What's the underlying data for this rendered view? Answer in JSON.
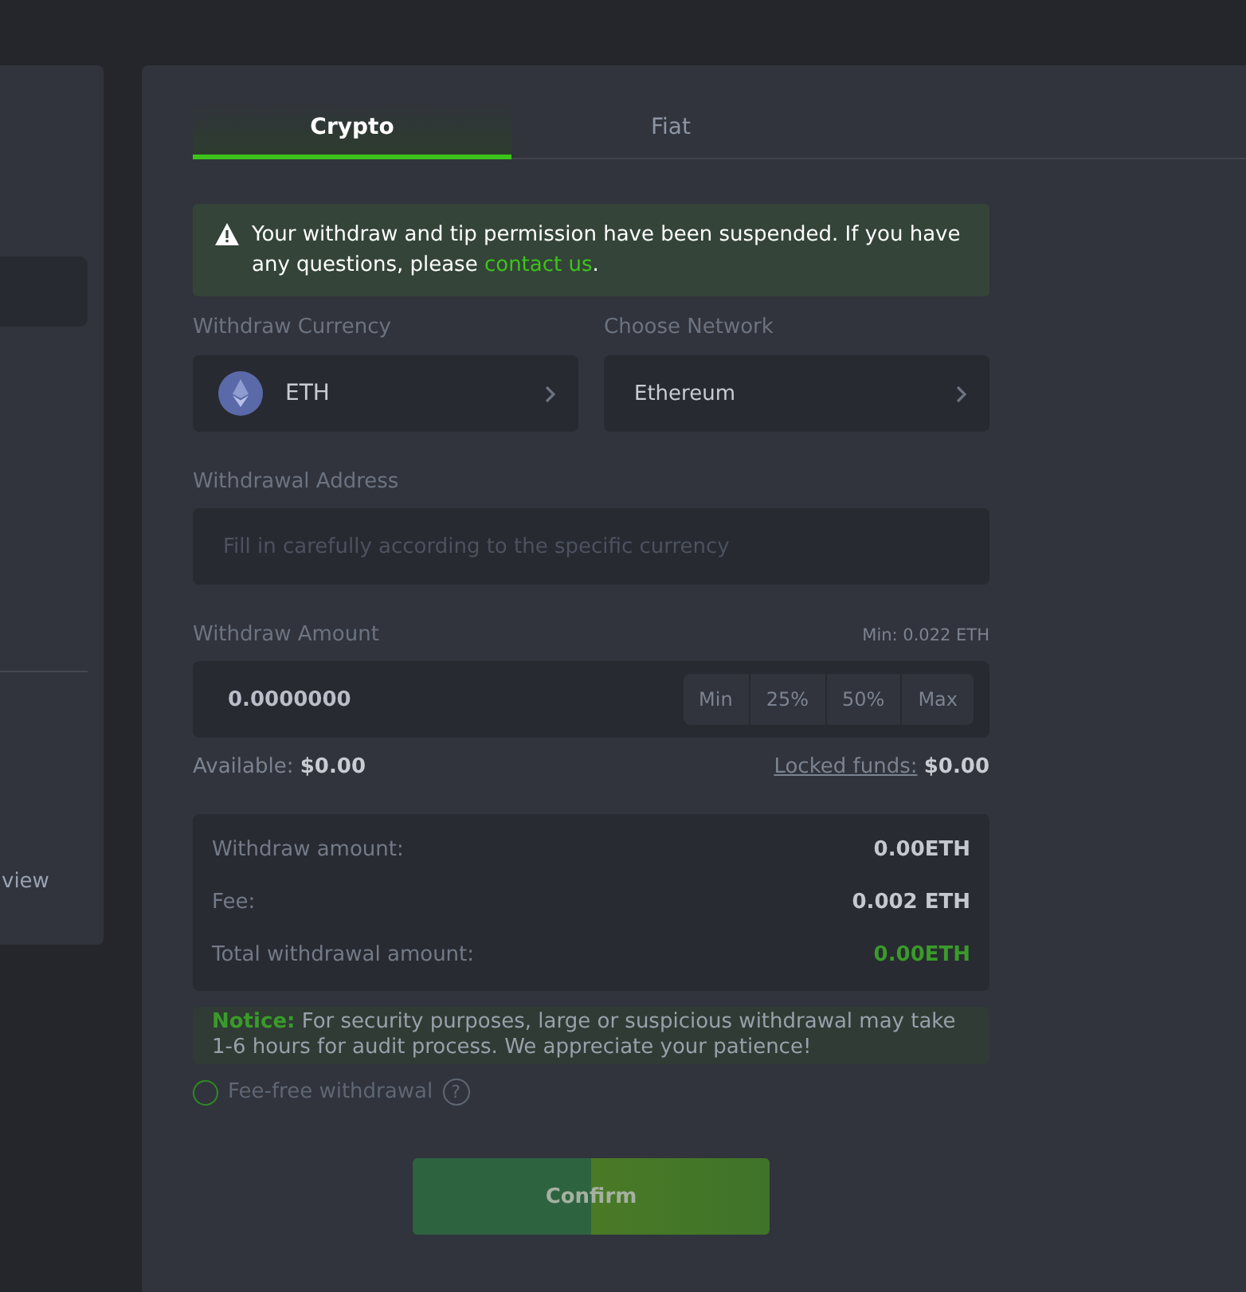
{
  "sidebar": {
    "footer_link": "view"
  },
  "tabs": [
    {
      "label": "Crypto",
      "selected": true
    },
    {
      "label": "Fiat",
      "selected": false
    }
  ],
  "alert": {
    "text": "Your withdraw and tip permission have been suspended. If you have any questions, please ",
    "link": "contact us",
    "after": "."
  },
  "currency": {
    "label": "Withdraw Currency",
    "value": "ETH"
  },
  "network": {
    "label": "Choose Network",
    "value": "Ethereum"
  },
  "address": {
    "label": "Withdrawal Address",
    "placeholder": "Fill in carefully according to the specific currency"
  },
  "amount": {
    "label": "Withdraw Amount",
    "min_note": "Min: 0.022 ETH",
    "value": "0.0000000",
    "quick_buttons": [
      "Min",
      "25%",
      "50%",
      "Max"
    ]
  },
  "available": {
    "label": "Available:",
    "value": "$0.00"
  },
  "locked": {
    "label": "Locked funds:",
    "value": "$0.00"
  },
  "summary": [
    {
      "label": "Withdraw amount:",
      "value": "0.00ETH",
      "kind": "plain"
    },
    {
      "label": "Fee:",
      "value": "0.002 ETH",
      "kind": "plain"
    },
    {
      "label": "Total withdrawal amount:",
      "value": "0.00ETH",
      "kind": "total"
    }
  ],
  "notice": "**Notice:** For security purposes, large or suspicious withdrawal may take 1-6 hours for audit process. We appreciate your patience!",
  "fee_free": {
    "label": "Fee-free withdrawal",
    "checked": false,
    "help": "?"
  },
  "confirm": "Confirm"
}
